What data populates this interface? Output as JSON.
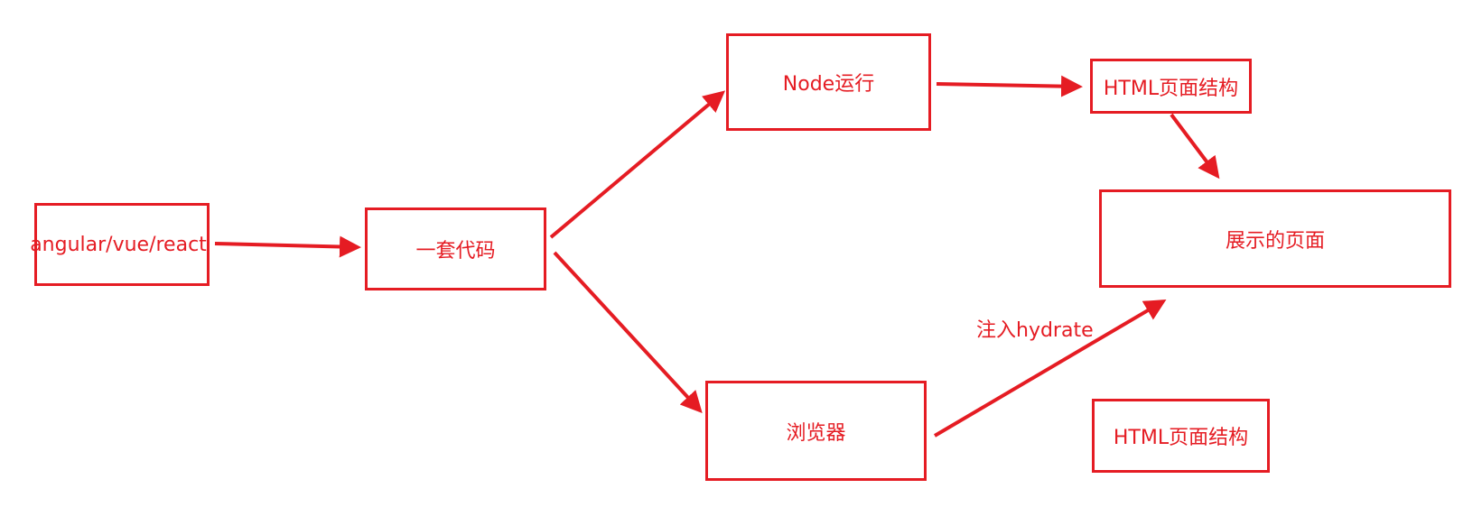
{
  "diagram": {
    "nodes": {
      "source": "angular/vue/react",
      "code": "一套代码",
      "node_run": "Node运行",
      "html_structure_top": "HTML页面结构",
      "display_page": "展示的页面",
      "browser": "浏览器",
      "html_structure_bottom": "HTML页面结构"
    },
    "edge_labels": {
      "hydrate": "注入hydrate"
    },
    "edges": [
      [
        "source",
        "code"
      ],
      [
        "code",
        "node_run"
      ],
      [
        "code",
        "browser"
      ],
      [
        "node_run",
        "html_structure_top"
      ],
      [
        "html_structure_top",
        "display_page"
      ],
      [
        "browser",
        "display_page"
      ]
    ]
  },
  "colors": {
    "stroke": "#e51c23",
    "text": "#e51c23",
    "background": "#ffffff"
  }
}
